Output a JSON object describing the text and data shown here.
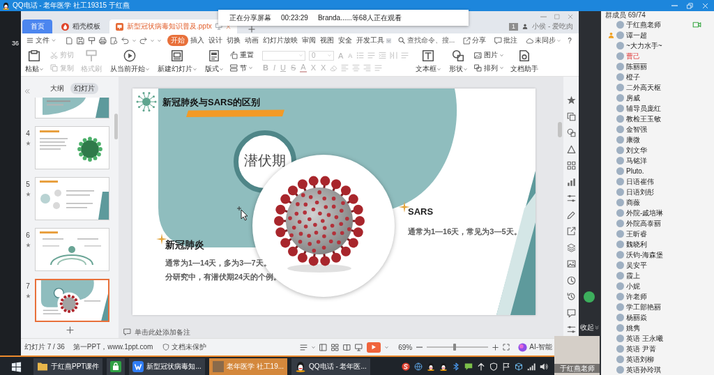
{
  "call_window": {
    "title": "QQ电话 - 老年医学 社工19315 于红燕"
  },
  "share_banner": {
    "status": "正在分享屏幕",
    "duration": "00:23:29",
    "viewers": "Branda......等68人正在观看"
  },
  "desktop": {
    "icon_label": "36"
  },
  "wps": {
    "tabs": [
      {
        "label": "首页",
        "kind": "home",
        "selected": false
      },
      {
        "label": "稻壳模板",
        "kind": "template",
        "selected": false
      },
      {
        "label": "新型冠状病毒知识普及.pptx",
        "kind": "document",
        "selected": true
      }
    ],
    "notification_count": "1",
    "user": "小侯 - 爱吃肉",
    "file_menu": "文件",
    "ribbon_tabs": [
      {
        "label": "开始",
        "selected": true
      },
      {
        "label": "插入",
        "selected": false
      },
      {
        "label": "设计",
        "selected": false
      },
      {
        "label": "切换",
        "selected": false
      },
      {
        "label": "动画",
        "selected": false
      },
      {
        "label": "幻灯片放映",
        "selected": false
      },
      {
        "label": "审阅",
        "selected": false
      },
      {
        "label": "视图",
        "selected": false
      },
      {
        "label": "安全",
        "selected": false
      },
      {
        "label": "开发工具",
        "selected": false
      }
    ],
    "search": {
      "placeholder": "查找命令、搜..."
    },
    "actions": [
      {
        "label": "分享",
        "dropdown": false
      },
      {
        "label": "批注",
        "dropdown": false
      },
      {
        "label": "未同步",
        "dropdown": true
      }
    ],
    "help": "?",
    "ribbon": [
      {
        "kind": "large",
        "label": "粘贴",
        "dropdown": true,
        "disabled": false
      },
      {
        "kind": "stack",
        "items": [
          {
            "label": "剪切",
            "dropdown": false,
            "disabled": true
          },
          {
            "label": "复制",
            "dropdown": false,
            "disabled": true
          }
        ]
      },
      {
        "kind": "large",
        "label": "格式刷",
        "dropdown": false,
        "disabled": true
      },
      {
        "kind": "large",
        "label": "从当前开始",
        "dropdown": true,
        "disabled": false
      },
      {
        "kind": "large",
        "label": "新建幻灯片",
        "dropdown": true,
        "disabled": false
      },
      {
        "kind": "large",
        "label": "版式",
        "dropdown": true,
        "disabled": false
      },
      {
        "kind": "stack",
        "items": [
          {
            "label": "重置",
            "dropdown": false,
            "disabled": false
          },
          {
            "label": "节",
            "dropdown": true,
            "disabled": false
          }
        ]
      },
      {
        "kind": "font",
        "size": "0",
        "size_buttons": [
          "A",
          "A"
        ],
        "style_buttons": [
          "B",
          "I",
          "U",
          "S",
          "A",
          "X",
          "X"
        ],
        "disabled": true
      },
      {
        "kind": "large",
        "label": "文本框",
        "dropdown": true,
        "disabled": false
      },
      {
        "kind": "large",
        "label": "形状",
        "dropdown": true,
        "disabled": false
      },
      {
        "kind": "stack",
        "items": [
          {
            "label": "图片",
            "dropdown": true,
            "disabled": false
          },
          {
            "label": "排列",
            "dropdown": true,
            "disabled": false
          }
        ]
      },
      {
        "kind": "large",
        "label": "文档助手",
        "dropdown": false,
        "disabled": false
      }
    ],
    "panel_tabs": [
      {
        "label": "大纲",
        "selected": false
      },
      {
        "label": "幻灯片",
        "selected": true
      }
    ],
    "slides": [
      {
        "kind": "cut",
        "animated": false,
        "selected": false
      },
      {
        "kind": "full",
        "number": "4",
        "animated": true,
        "selected": false
      },
      {
        "kind": "full",
        "number": "5",
        "animated": true,
        "selected": false
      },
      {
        "kind": "full",
        "number": "6",
        "animated": true,
        "selected": false
      },
      {
        "kind": "full",
        "number": "7",
        "animated": true,
        "selected": true
      }
    ],
    "slide": {
      "title": "新冠肺炎与SARS的区别",
      "center_label": "潜伏期",
      "sections": [
        {
          "heading": "SARS",
          "lines": [
            "通常为1—16天，常见为3—5天。"
          ]
        },
        {
          "heading": "新冠肺炎",
          "lines": [
            "通常为1—14天，多为3—7天。",
            "分研究中，有潜伏期24天的个例。"
          ]
        }
      ]
    },
    "notes": {
      "placeholder": "单击此处添加备注"
    },
    "status_bar": {
      "slide_counter": "幻灯片 7 / 36",
      "template": "第一PPT，www.1ppt.com",
      "protection": "文档未保护",
      "zoom": "69%",
      "zoom_slider": {
        "level": 0.45
      },
      "ai_label": "AI-智能"
    }
  },
  "side_panel": {
    "collapse": "收起"
  },
  "members": {
    "title": "群成员 69/74",
    "items": [
      {
        "name": "于红燕老师",
        "kind": "host"
      },
      {
        "name": "谭一超",
        "kind": "admin"
      },
      {
        "name": "~大力水手~",
        "kind": "member"
      },
      {
        "name": "曹己",
        "kind": "vip"
      },
      {
        "name": "陈丽丽",
        "kind": "member"
      },
      {
        "name": "橙子",
        "kind": "member"
      },
      {
        "name": "二外高天枢",
        "kind": "member"
      },
      {
        "name": "房威",
        "kind": "member"
      },
      {
        "name": "辅导员庞红",
        "kind": "member"
      },
      {
        "name": "教检王玉敏",
        "kind": "member"
      },
      {
        "name": "金智强",
        "kind": "member"
      },
      {
        "name": "康微",
        "kind": "member"
      },
      {
        "name": "刘文华",
        "kind": "member"
      },
      {
        "name": "马铭洋",
        "kind": "member"
      },
      {
        "name": "Pluto.",
        "kind": "member"
      },
      {
        "name": "日语崔伟",
        "kind": "member"
      },
      {
        "name": "日语刘彤",
        "kind": "member"
      },
      {
        "name": "商薇",
        "kind": "member"
      },
      {
        "name": "外院-戚培琳",
        "kind": "member"
      },
      {
        "name": "外院高泰丽",
        "kind": "member"
      },
      {
        "name": "王昕睿",
        "kind": "member"
      },
      {
        "name": "魏晓利",
        "kind": "member"
      },
      {
        "name": "沃钧-海森堡",
        "kind": "member"
      },
      {
        "name": "吴安平",
        "kind": "member"
      },
      {
        "name": "霞上",
        "kind": "member"
      },
      {
        "name": "小妮",
        "kind": "member"
      },
      {
        "name": "许老师",
        "kind": "member"
      },
      {
        "name": "学工部艳丽",
        "kind": "member"
      },
      {
        "name": "杨丽焱",
        "kind": "member"
      },
      {
        "name": "姚隽",
        "kind": "member"
      },
      {
        "name": "英语 王永曦",
        "kind": "member"
      },
      {
        "name": "英语 尹菁",
        "kind": "member"
      },
      {
        "name": "英语刘柳",
        "kind": "member"
      },
      {
        "name": "英语孙玲琪",
        "kind": "member"
      }
    ]
  },
  "taskbar": {
    "items": [
      {
        "kind": "folder",
        "label": "于红燕PPT课件",
        "selected": false
      },
      {
        "kind": "store",
        "selected": false
      },
      {
        "kind": "app",
        "label": "新型冠状病毒知...",
        "selected": false
      },
      {
        "kind": "chat",
        "label": "老年医学 社工19...",
        "selected": true
      },
      {
        "kind": "qq",
        "label": "QQ电话 - 老年医...",
        "selected": false
      }
    ]
  },
  "video": {
    "caption": "于红燕老师"
  }
}
